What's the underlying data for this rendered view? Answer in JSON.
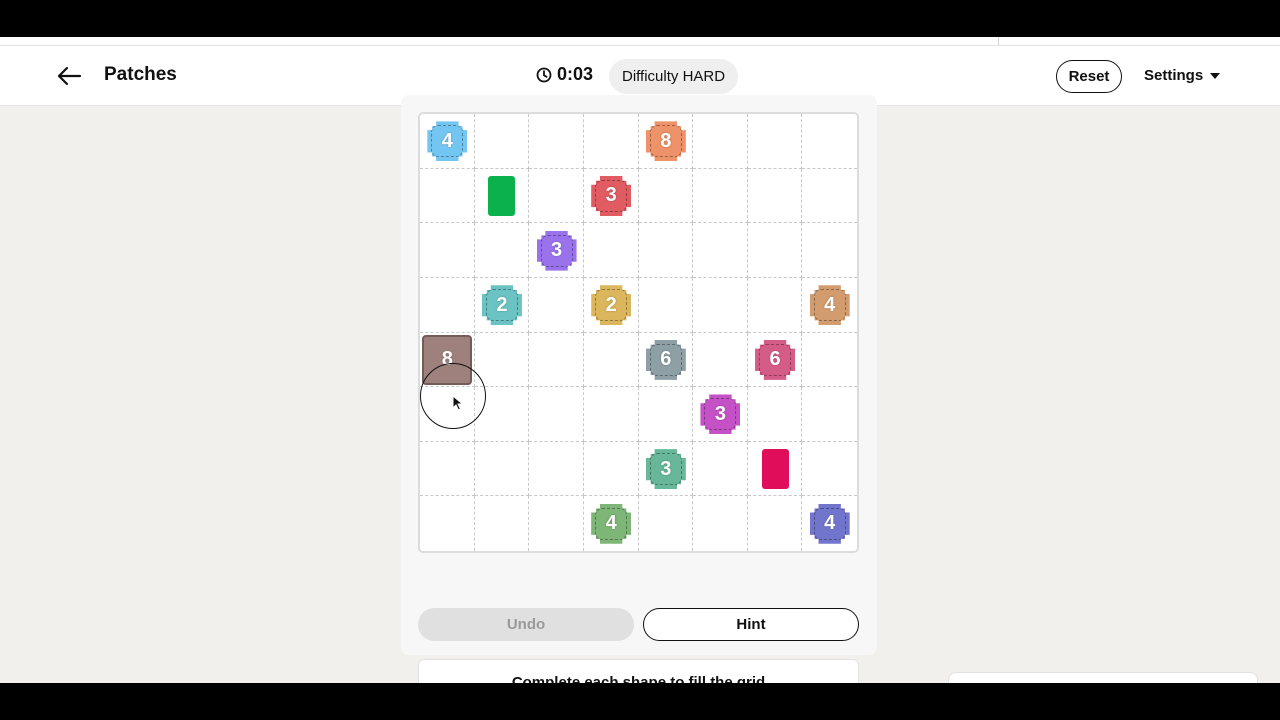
{
  "header": {
    "title": "Patches",
    "timer": "0:03",
    "difficulty": "Difficulty HARD",
    "reset_label": "Reset",
    "settings_label": "Settings"
  },
  "board": {
    "rows": 8,
    "cols": 8,
    "clues": [
      {
        "row": 0,
        "col": 0,
        "value": "4",
        "color": "#74c6f2"
      },
      {
        "row": 0,
        "col": 4,
        "value": "8",
        "color": "#ee9269"
      },
      {
        "row": 1,
        "col": 3,
        "value": "3",
        "color": "#e05c62"
      },
      {
        "row": 2,
        "col": 2,
        "value": "3",
        "color": "#9a73ec"
      },
      {
        "row": 3,
        "col": 1,
        "value": "2",
        "color": "#6cc3c4"
      },
      {
        "row": 3,
        "col": 3,
        "value": "2",
        "color": "#dcb65c"
      },
      {
        "row": 3,
        "col": 7,
        "value": "4",
        "color": "#d39c6e"
      },
      {
        "row": 4,
        "col": 0,
        "value": "8",
        "color": "#8e6a66",
        "selected": true
      },
      {
        "row": 4,
        "col": 4,
        "value": "6",
        "color": "#8e9fa6"
      },
      {
        "row": 4,
        "col": 6,
        "value": "6",
        "color": "#d65c88"
      },
      {
        "row": 5,
        "col": 5,
        "value": "3",
        "color": "#c452c6"
      },
      {
        "row": 6,
        "col": 4,
        "value": "3",
        "color": "#68b79a"
      },
      {
        "row": 7,
        "col": 3,
        "value": "4",
        "color": "#7db676"
      },
      {
        "row": 7,
        "col": 7,
        "value": "4",
        "color": "#7275cc"
      }
    ],
    "blocks": [
      {
        "row": 1,
        "col": 1,
        "color": "#0bb24c"
      },
      {
        "row": 6,
        "col": 6,
        "color": "#df0d5a"
      }
    ]
  },
  "controls": {
    "undo_label": "Undo",
    "hint_label": "Hint"
  },
  "instructions": "Complete each shape to fill the grid"
}
